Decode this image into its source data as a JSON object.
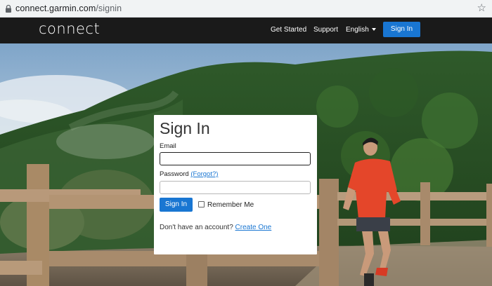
{
  "browser": {
    "url_host": "connect.garmin.com",
    "url_path": "/signin"
  },
  "nav": {
    "logo": "connect",
    "get_started": "Get Started",
    "support": "Support",
    "language": "English",
    "signin": "Sign In"
  },
  "form": {
    "title": "Sign In",
    "email_label": "Email",
    "email_value": "",
    "password_label": "Password",
    "forgot_link": "(Forgot?)",
    "password_value": "",
    "signin_button": "Sign In",
    "remember_label": "Remember Me",
    "no_account_text": "Don't have an account?",
    "create_link": "Create One"
  },
  "colors": {
    "accent": "#1976d2",
    "navbar": "#1a1a1a"
  }
}
